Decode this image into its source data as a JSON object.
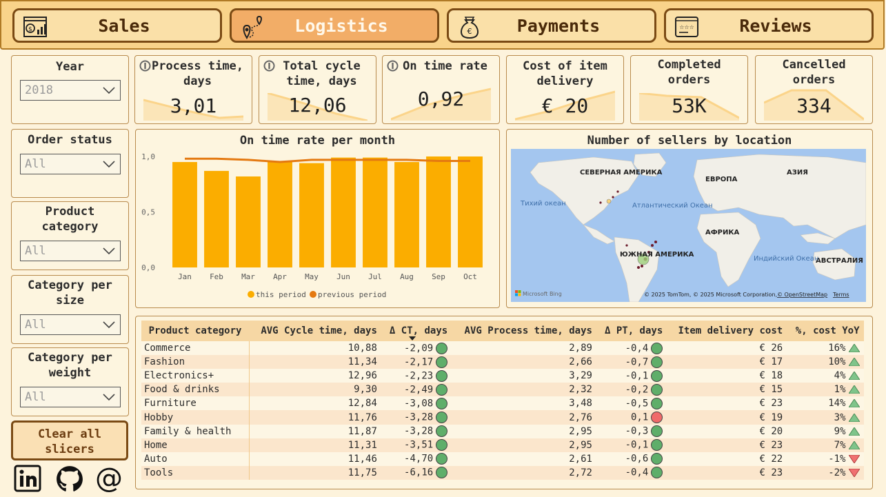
{
  "nav": [
    {
      "label": "Sales",
      "icon": "sales-dashboard-icon"
    },
    {
      "label": "Logistics",
      "icon": "map-route-icon",
      "active": true
    },
    {
      "label": "Payments",
      "icon": "money-bag-euro-icon"
    },
    {
      "label": "Reviews",
      "icon": "star-rating-icon"
    }
  ],
  "slicers": [
    {
      "title": "Year",
      "value": "2018"
    },
    {
      "title": "Order status",
      "value": "All"
    },
    {
      "title": "Product category",
      "value": "All"
    },
    {
      "title": "Category per size",
      "value": "All"
    },
    {
      "title": "Category per weight",
      "value": "All"
    }
  ],
  "clear_button": "Clear all slicers",
  "social": [
    "linkedin-icon",
    "github-icon",
    "email-at-icon"
  ],
  "kpis": [
    {
      "title": "Process time, days",
      "value": "3,01",
      "info": true
    },
    {
      "title": "Total cycle time, days",
      "value": "12,06",
      "info": true
    },
    {
      "title": "On time rate",
      "value": "0,92",
      "info": true
    },
    {
      "title": "Cost of item delivery",
      "value": "€ 20",
      "info": false
    },
    {
      "title": "Completed orders",
      "value": "53K",
      "info": false
    },
    {
      "title": "Cancelled orders",
      "value": "334",
      "info": false
    }
  ],
  "colors": {
    "accent": "#fbad00",
    "line": "#e47911",
    "green": "#5fae6a",
    "red": "#f06a6a"
  },
  "chart_data": {
    "type": "bar",
    "title": "On time rate per month",
    "categories": [
      "Jan",
      "Feb",
      "Mar",
      "Apr",
      "May",
      "Jun",
      "Jul",
      "Aug",
      "Sep",
      "Oct"
    ],
    "series": [
      {
        "name": "this period",
        "values": [
          0.95,
          0.87,
          0.82,
          0.96,
          0.94,
          0.99,
          0.99,
          0.95,
          1.0,
          1.0
        ]
      },
      {
        "name": "previous period",
        "values": [
          0.98,
          0.98,
          0.97,
          0.95,
          0.97,
          0.97,
          0.97,
          0.97,
          0.96,
          0.96
        ]
      }
    ],
    "yticks": [
      "0,0",
      "0,5",
      "1,0"
    ],
    "ylim": [
      0,
      1.0
    ],
    "legend": "bottom"
  },
  "map": {
    "title": "Number of sellers by location",
    "labels": [
      "СЕВЕРНАЯ АМЕРИКА",
      "ЕВРОПА",
      "АЗИЯ",
      "Атлантический Океан",
      "Тихий океан",
      "АФРИКА",
      "ЮЖНАЯ АМЕРИКА",
      "Индийский Океан",
      "АВСТРАЛИЯ"
    ],
    "bing": "Microsoft Bing",
    "copyright": "© 2025 TomTom, © 2025 Microsoft Corporation,",
    "osm": "© OpenStreetMap",
    "terms": "Terms"
  },
  "table": {
    "headers": [
      "Product category",
      "AVG Cycle time, days",
      "Δ CT, days",
      "AVG Process time, days",
      "Δ PT, days",
      "Item delivery cost",
      "%, cost YoY"
    ],
    "rows": [
      {
        "cat": "Commerce",
        "ct": "10,88",
        "dct": "-2,09",
        "pt": "2,89",
        "dpt": "-0,4",
        "pt_status": "green",
        "cost": "€ 26",
        "yoy": "16%",
        "trend": "up"
      },
      {
        "cat": "Fashion",
        "ct": "11,34",
        "dct": "-2,17",
        "pt": "2,66",
        "dpt": "-0,7",
        "pt_status": "green",
        "cost": "€ 17",
        "yoy": "10%",
        "trend": "up"
      },
      {
        "cat": "Electronics+",
        "ct": "12,96",
        "dct": "-2,23",
        "pt": "3,29",
        "dpt": "-0,1",
        "pt_status": "green",
        "cost": "€ 18",
        "yoy": "4%",
        "trend": "up"
      },
      {
        "cat": "Food & drinks",
        "ct": "9,30",
        "dct": "-2,49",
        "pt": "2,32",
        "dpt": "-0,2",
        "pt_status": "green",
        "cost": "€ 15",
        "yoy": "1%",
        "trend": "up"
      },
      {
        "cat": "Furniture",
        "ct": "12,84",
        "dct": "-3,08",
        "pt": "3,48",
        "dpt": "-0,5",
        "pt_status": "green",
        "cost": "€ 23",
        "yoy": "14%",
        "trend": "up"
      },
      {
        "cat": "Hobby",
        "ct": "11,76",
        "dct": "-3,28",
        "pt": "2,76",
        "dpt": "0,1",
        "pt_status": "red",
        "cost": "€ 19",
        "yoy": "3%",
        "trend": "up"
      },
      {
        "cat": "Family & health",
        "ct": "11,87",
        "dct": "-3,28",
        "pt": "2,95",
        "dpt": "-0,3",
        "pt_status": "green",
        "cost": "€ 20",
        "yoy": "9%",
        "trend": "up"
      },
      {
        "cat": "Home",
        "ct": "11,31",
        "dct": "-3,51",
        "pt": "2,95",
        "dpt": "-0,1",
        "pt_status": "green",
        "cost": "€ 23",
        "yoy": "7%",
        "trend": "up"
      },
      {
        "cat": "Auto",
        "ct": "11,46",
        "dct": "-4,70",
        "pt": "2,61",
        "dpt": "-0,6",
        "pt_status": "green",
        "cost": "€ 22",
        "yoy": "-1%",
        "trend": "down"
      },
      {
        "cat": "Tools",
        "ct": "11,75",
        "dct": "-6,16",
        "pt": "2,72",
        "dpt": "-0,4",
        "pt_status": "green",
        "cost": "€ 23",
        "yoy": "-2%",
        "trend": "down"
      }
    ]
  }
}
